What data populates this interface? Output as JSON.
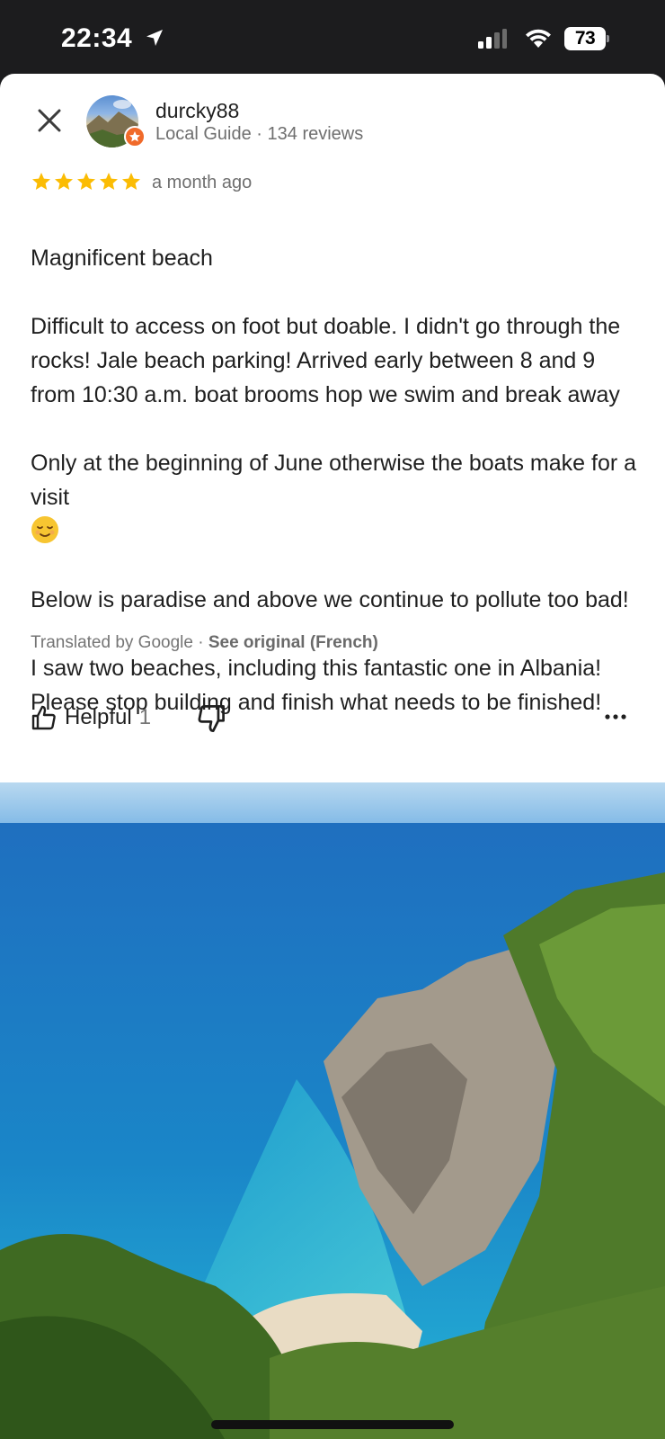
{
  "status_bar": {
    "time": "22:34",
    "battery": "73",
    "location_icon": "location-arrow-icon",
    "signal_icon": "cellular-signal-icon",
    "wifi_icon": "wifi-icon"
  },
  "review": {
    "close_icon": "close-icon",
    "author": "durcky88",
    "author_meta": "Local Guide · 134 reviews",
    "rating": 5,
    "rating_max": 5,
    "date": "a month ago",
    "text_lines": [
      "Magnificent beach",
      "Difficult to access on foot but doable. I didn't go through the rocks! Jale beach parking! Arrived early between 8 and 9 from 10:30 a.m. boat brooms hop we swim and break away",
      "Only at the beginning of June otherwise the boats make for a visit",
      "Below is paradise and above we continue to pollute too bad!",
      "I saw two beaches, including this fantastic one in Albania! Please stop building and finish what needs to be finished!"
    ],
    "translated_by": "Translated by Google · ",
    "see_original": "See original (French)",
    "helpful_label": "Helpful",
    "helpful_count": "1"
  },
  "colors": {
    "star": "#fbbc04",
    "badge": "#f06a2a",
    "status_bar_bg": "#1c1c1e"
  }
}
